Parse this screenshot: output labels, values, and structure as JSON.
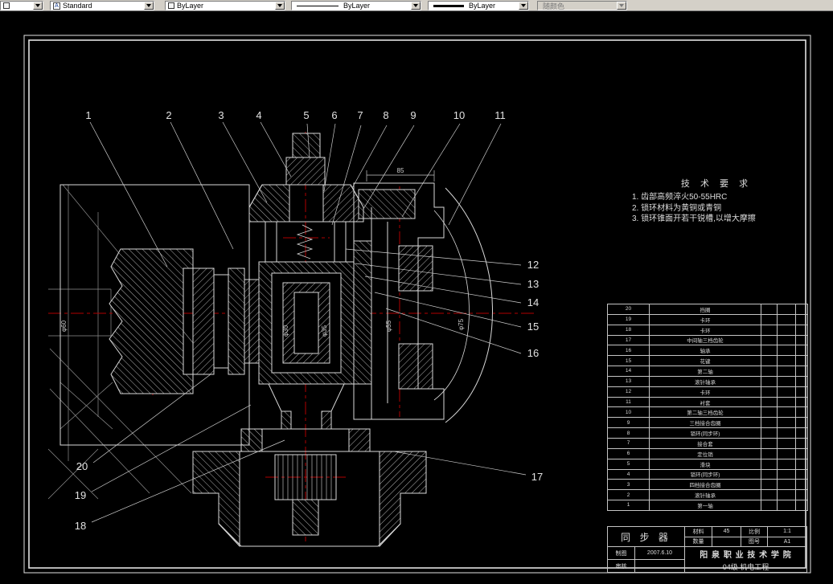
{
  "toolbar": {
    "combo_left": "",
    "style": "Standard",
    "layer": "ByLayer",
    "linetype": "ByLayer",
    "lineweight": "ByLayer",
    "plot_style": "随颜色"
  },
  "drawing": {
    "callouts_top": [
      "1",
      "2",
      "3",
      "4",
      "5",
      "6",
      "7",
      "8",
      "9",
      "10",
      "11"
    ],
    "callouts_right": [
      "12",
      "13",
      "14",
      "15",
      "16"
    ],
    "callout_mid_right": "17",
    "callouts_left_bottom": [
      "20",
      "19",
      "18"
    ],
    "dims": {
      "top": "85",
      "left": "φ60",
      "center_left": "φ30",
      "center": "φ35",
      "right": "φ55",
      "far_right": "φ75"
    },
    "tech_req": {
      "title": "技 术 要 求",
      "items": [
        "1. 齿部高频淬火50-55HRC",
        "2. 锁环材料为黄铜或青铜",
        "3. 锁环锥面开若干锐槽,以增大摩擦"
      ]
    }
  },
  "parts_table": {
    "rows": [
      {
        "no": "20",
        "name": "挡圈"
      },
      {
        "no": "19",
        "name": "卡环"
      },
      {
        "no": "18",
        "name": "卡环"
      },
      {
        "no": "17",
        "name": "中间轴三档齿轮"
      },
      {
        "no": "16",
        "name": "轴承"
      },
      {
        "no": "15",
        "name": "花键"
      },
      {
        "no": "14",
        "name": "第二轴"
      },
      {
        "no": "13",
        "name": "滚针轴承"
      },
      {
        "no": "12",
        "name": "卡环"
      },
      {
        "no": "11",
        "name": "衬套"
      },
      {
        "no": "10",
        "name": "第二轴三档齿轮"
      },
      {
        "no": "9",
        "name": "三档接合齿圈"
      },
      {
        "no": "8",
        "name": "锁环(同步环)"
      },
      {
        "no": "7",
        "name": "接合套"
      },
      {
        "no": "6",
        "name": "定位销"
      },
      {
        "no": "5",
        "name": "滑块"
      },
      {
        "no": "4",
        "name": "锁环(同步环)"
      },
      {
        "no": "3",
        "name": "四档接合齿圈"
      },
      {
        "no": "2",
        "name": "滚针轴承"
      },
      {
        "no": "1",
        "name": "第一轴"
      }
    ]
  },
  "title_block": {
    "part_name": "同 步 器",
    "material_label": "材料",
    "material_value": "45",
    "scale_label": "比例",
    "scale_value": "1:1",
    "qty_label": "数量",
    "qty_value": "",
    "sheet_label": "图号",
    "sheet_value": "A1",
    "drawn_label": "制图",
    "date": "2007.6.10",
    "checked_label": "审核",
    "school": "阳 泉 职 业 技 术 学 院",
    "dept": "04级   机电工程"
  }
}
